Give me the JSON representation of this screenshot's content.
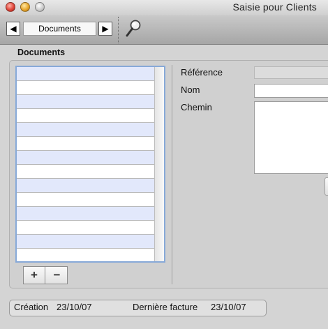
{
  "window": {
    "title": "Saisie pour Clients"
  },
  "toolbar": {
    "prev_icon": "◀",
    "next_icon": "▶",
    "current_record": "Documents",
    "search_icon": "magnifier-icon"
  },
  "documents": {
    "section_title": "Documents",
    "rows": [
      "",
      "",
      "",
      "",
      "",
      "",
      "",
      "",
      "",
      "",
      "",
      "",
      "",
      ""
    ],
    "add_label": "+",
    "remove_label": "−"
  },
  "form": {
    "reference_label": "Référence",
    "reference_value": "",
    "nom_label": "Nom",
    "nom_value": "",
    "chemin_label": "Chemin",
    "chemin_value": ""
  },
  "status": {
    "creation_label": "Création",
    "creation_date": "23/10/07",
    "last_invoice_label": "Dernière facture",
    "last_invoice_date": "23/10/07"
  },
  "colors": {
    "list_alt_row": "#e2e8fb",
    "list_focus_border": "#87a9d8"
  }
}
